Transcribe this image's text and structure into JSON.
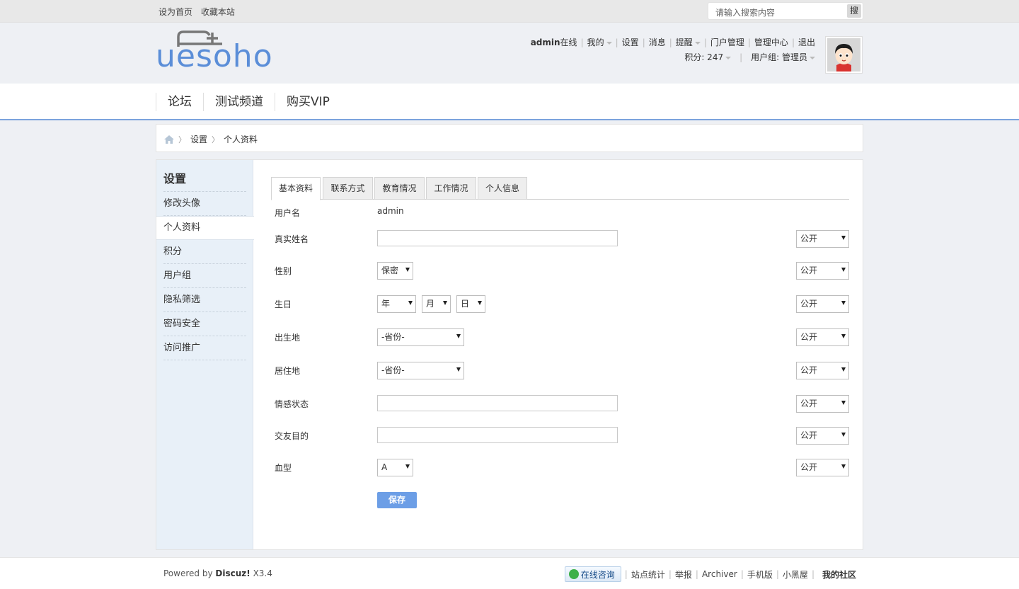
{
  "topbar": {
    "set_home": "设为首页",
    "bookmark": "收藏本站",
    "search_placeholder": "请输入搜索内容",
    "search_button": "搜"
  },
  "header": {
    "logo_text": "uesoho",
    "username": "admin",
    "online": "在线",
    "my": "我的",
    "settings": "设置",
    "messages": "消息",
    "reminders": "提醒",
    "portal_admin": "门户管理",
    "admin_center": "管理中心",
    "logout": "退出",
    "points": "积分: 247",
    "usergroup": "用户组: 管理员"
  },
  "nav": {
    "items": [
      "论坛",
      "测试频道",
      "购买VIP"
    ]
  },
  "breadcrumb": {
    "settings": "设置",
    "current": "个人资料"
  },
  "sidebar": {
    "title": "设置",
    "items": [
      "修改头像",
      "个人资料",
      "积分",
      "用户组",
      "隐私筛选",
      "密码安全",
      "访问推广"
    ],
    "active_index": 1
  },
  "tabs": [
    "基本资料",
    "联系方式",
    "教育情况",
    "工作情况",
    "个人信息"
  ],
  "form": {
    "username_label": "用户名",
    "username_value": "admin",
    "realname_label": "真实姓名",
    "gender_label": "性别",
    "gender_value": "保密",
    "birthday_label": "生日",
    "year": "年",
    "month": "月",
    "day": "日",
    "birthplace_label": "出生地",
    "province": "-省份-",
    "residence_label": "居住地",
    "relationship_label": "情感状态",
    "purpose_label": "交友目的",
    "blood_label": "血型",
    "blood_value": "A",
    "privacy_value": "公开",
    "save": "保存"
  },
  "footer": {
    "powered_by": "Powered by",
    "brand": "Discuz!",
    "version": "X3.4",
    "consult": "在线咨询",
    "stats": "站点统计",
    "report": "举报",
    "archiver": "Archiver",
    "mobile": "手机版",
    "blackroom": "小黑屋",
    "community": "我的社区"
  },
  "colors": {
    "accent": "#6c9ee6",
    "nav_border": "#7ba3dd",
    "sidebar_bg": "#e8f0f8"
  }
}
